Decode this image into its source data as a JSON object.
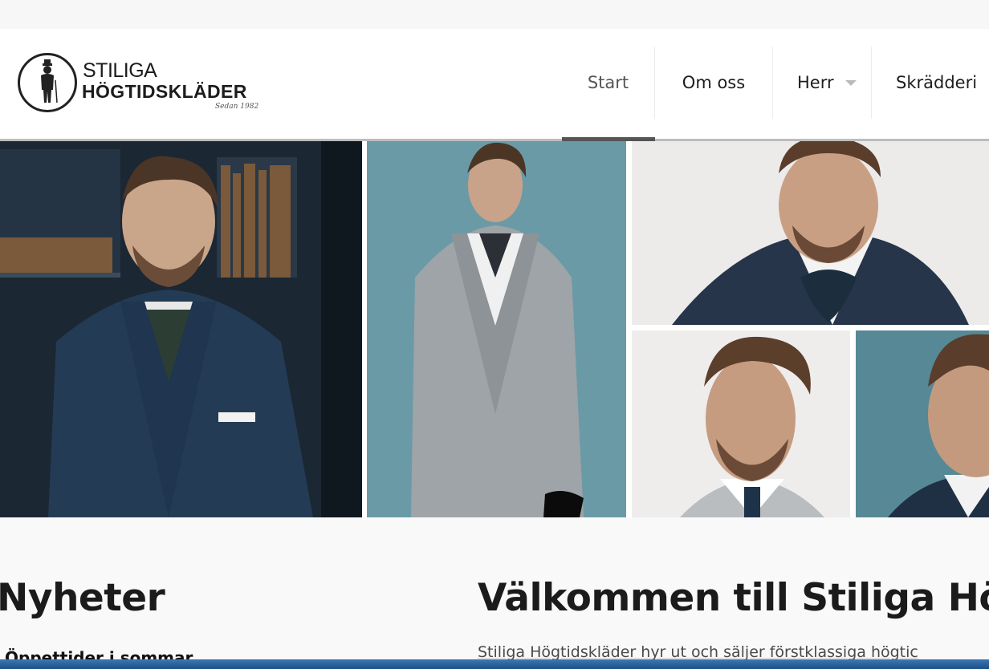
{
  "brand": {
    "line1": "STILIGA",
    "line2": "HÖGTIDSKLÄDER",
    "tagline": "Sedan 1982"
  },
  "nav": {
    "items": [
      {
        "label": "Start",
        "active": true
      },
      {
        "label": "Om oss"
      },
      {
        "label": "Herr",
        "has_dropdown": true
      },
      {
        "label": "Skrädderi"
      }
    ]
  },
  "hero": {
    "photos": [
      "groom-blue-suit-library",
      "groom-grey-suit-sky",
      "groom-navy-suit-ascot",
      "groom-portrait",
      "groom-portrait-cropped"
    ]
  },
  "news": {
    "title": "Nyheter",
    "first_item": "Öppettider i sommar"
  },
  "welcome": {
    "title": "Välkommen till Stiliga Hög",
    "text": "Stiliga Högtidskläder hyr ut och säljer förstklassiga högtic"
  },
  "colors": {
    "nav_active": "#555555",
    "bottom_bar": "#2a5f99"
  }
}
